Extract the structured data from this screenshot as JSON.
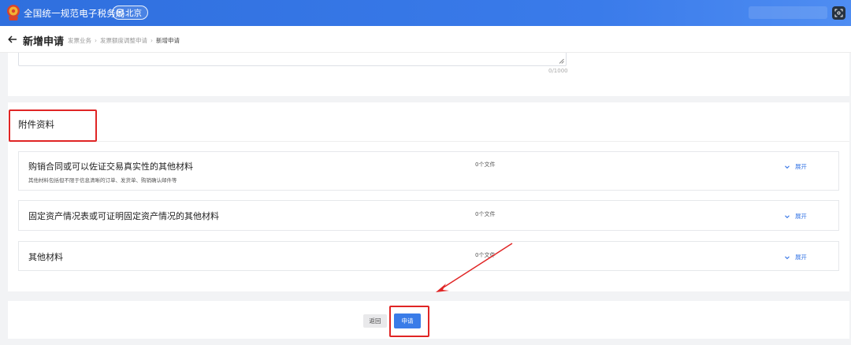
{
  "header": {
    "site_title": "全国统一规范电子税务局",
    "city": "北京",
    "icons": [
      "tax-emblem-icon",
      "location-pin-icon",
      "scan-icon"
    ]
  },
  "nav": {
    "page_title": "新增申请",
    "breadcrumbs": [
      "发票业务",
      "发票额度调整申请",
      "新增申请"
    ]
  },
  "textarea": {
    "char_count": "0/1000"
  },
  "attachments": {
    "section_title": "附件资料",
    "expand_label": "展开",
    "rows": [
      {
        "title": "购销合同或可以佐证交易真实性的其他材料",
        "description": "其他材料包括但不限于信息清晰的订单、发货单、购销确认邮件等",
        "file_count": "0个文件"
      },
      {
        "title": "固定资产情况表或可证明固定资产情况的其他材料",
        "description": "",
        "file_count": "0个文件"
      },
      {
        "title": "其他材料",
        "description": "",
        "file_count": "0个文件"
      }
    ]
  },
  "footer": {
    "back_label": "返回",
    "apply_label": "申请"
  },
  "colors": {
    "header_blue": "#3a7bea",
    "primary_button": "#3a7ce8",
    "annotation_red": "#e02525"
  }
}
